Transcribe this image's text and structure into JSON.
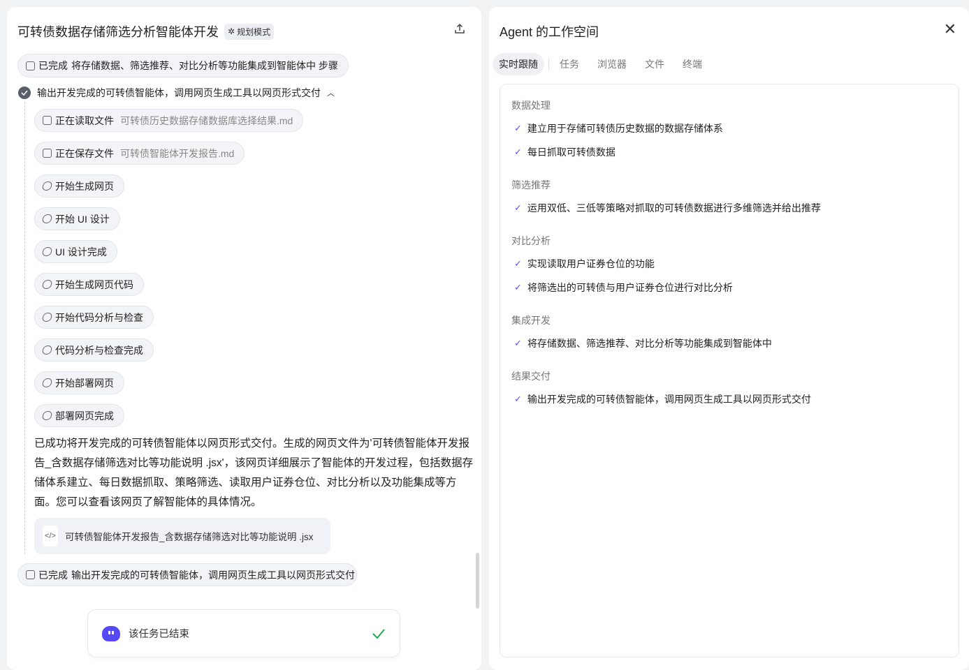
{
  "left": {
    "title": "可转债数据存储筛选分析智能体开发",
    "mode_badge": "规划模式",
    "prev_step": {
      "status": "已完成",
      "text": "将存储数据、筛选推荐、对比分析等功能集成到智能体中 步骤"
    },
    "current_step": "输出开发完成的可转债智能体，调用网页生成工具以网页形式交付",
    "actions": [
      {
        "label": "正在读取文件",
        "file": "可转债历史数据存储数据库选择结果.md",
        "icon": "folder-icon"
      },
      {
        "label": "正在保存文件",
        "file": "可转债智能体开发报告.md",
        "icon": "folder-icon"
      },
      {
        "label": "开始生成网页",
        "icon": "loading-icon"
      },
      {
        "label": "开始 UI 设计",
        "icon": "loading-icon"
      },
      {
        "label": "UI 设计完成",
        "icon": "loading-icon"
      },
      {
        "label": "开始生成网页代码",
        "icon": "loading-icon"
      },
      {
        "label": "开始代码分析与检查",
        "icon": "loading-icon"
      },
      {
        "label": "代码分析与检查完成",
        "icon": "loading-icon"
      },
      {
        "label": "开始部署网页",
        "icon": "loading-icon"
      },
      {
        "label": "部署网页完成",
        "icon": "loading-icon"
      }
    ],
    "summary": "已成功将开发完成的可转债智能体以网页形式交付。生成的网页文件为'可转债智能体开发报告_含数据存储筛选对比等功能说明 .jsx'，该网页详细展示了智能体的开发过程，包括数据存储体系建立、每日数据抓取、策略筛选、读取用户证券仓位、对比分析以及功能集成等方面。您可以查看该网页了解智能体的具体情况。",
    "file_card": "可转债智能体开发报告_含数据存储筛选对比等功能说明 .jsx",
    "final_step": {
      "status": "已完成",
      "text": "输出开发完成的可转债智能体，调用网页生成工具以网页形式交付"
    },
    "task_done": "该任务已结束"
  },
  "right": {
    "title": "Agent 的工作空间",
    "tabs": [
      "实时跟随",
      "任务",
      "浏览器",
      "文件",
      "终端"
    ],
    "active_tab": "实时跟随",
    "sections": [
      {
        "heading": "数据处理",
        "items": [
          "建立用于存储可转债历史数据的数据存储体系",
          "每日抓取可转债数据"
        ]
      },
      {
        "heading": "筛选推荐",
        "items": [
          "运用双低、三低等策略对抓取的可转债数据进行多维筛选并给出推荐"
        ]
      },
      {
        "heading": "对比分析",
        "items": [
          "实现读取用户证券仓位的功能",
          "将筛选出的可转债与用户证券仓位进行对比分析"
        ]
      },
      {
        "heading": "集成开发",
        "items": [
          "将存储数据、筛选推荐、对比分析等功能集成到智能体中"
        ]
      },
      {
        "heading": "结果交付",
        "items": [
          "输出开发完成的可转债智能体，调用网页生成工具以网页形式交付"
        ]
      }
    ]
  },
  "colors": {
    "accent": "#5548f5",
    "check": "#5b52e8",
    "success": "#1aad4b"
  }
}
